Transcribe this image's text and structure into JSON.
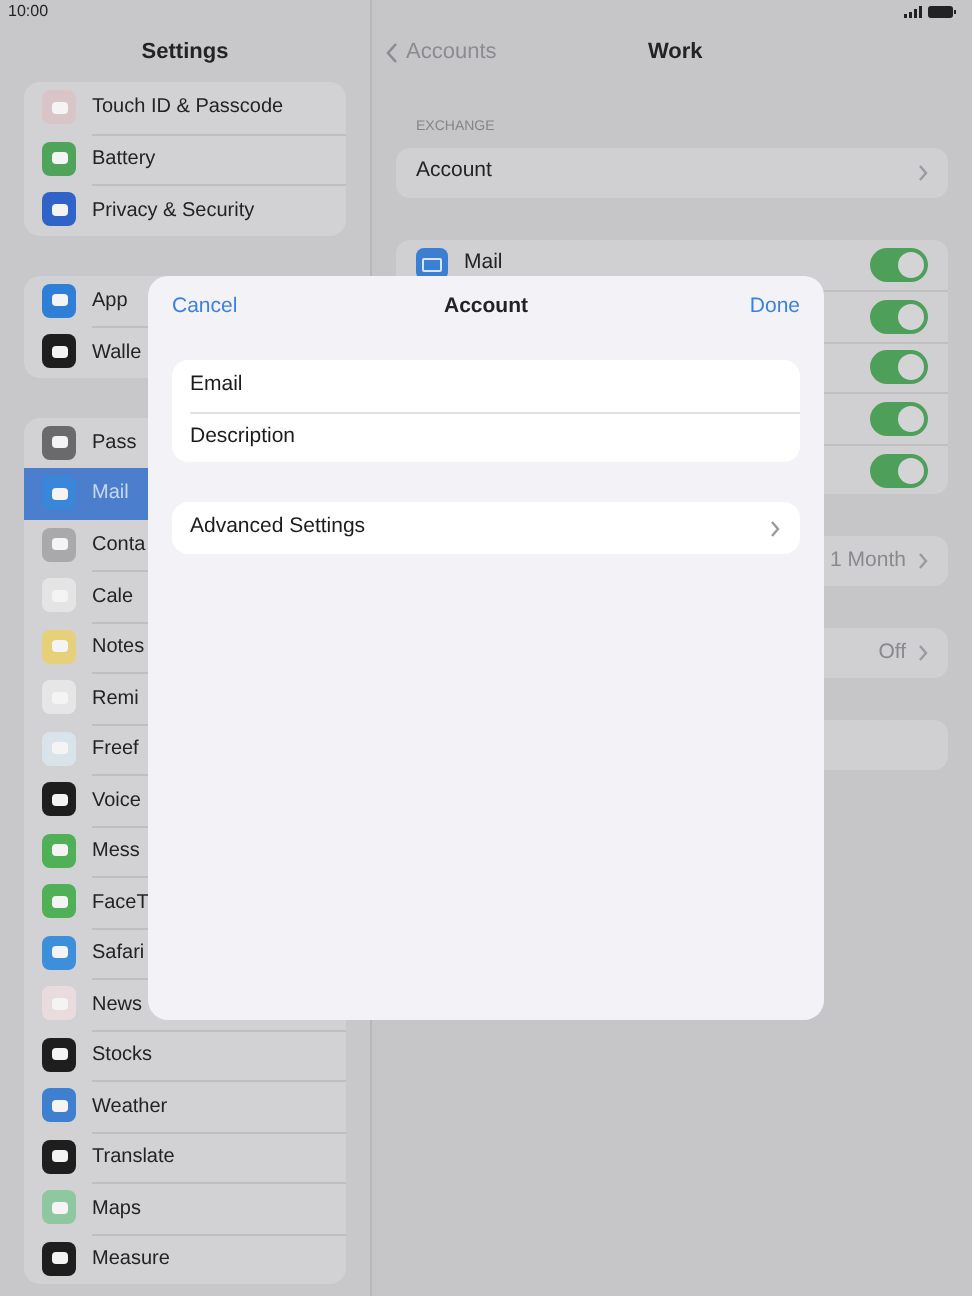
{
  "status_bar": {
    "time": "10:00"
  },
  "sidebar": {
    "title": "Settings",
    "groups": [
      [
        {
          "label": "Touch ID & Passcode",
          "color": "#d9c5c8",
          "selected": false
        },
        {
          "label": "Battery",
          "color": "#4fa35a",
          "selected": false
        },
        {
          "label": "Privacy & Security",
          "color": "#2f63c8",
          "selected": false
        }
      ],
      [
        {
          "label": "App",
          "color": "#2f7fd6",
          "selected": false
        },
        {
          "label": "Walle",
          "color": "#1e1e1e",
          "selected": false
        }
      ],
      [
        {
          "label": "Pass",
          "color": "#6a6a6c",
          "selected": false
        },
        {
          "label": "Mail",
          "color": "#3a86d9",
          "selected": true
        },
        {
          "label": "Conta",
          "color": "#a9a9ab",
          "selected": false
        },
        {
          "label": "Cale",
          "color": "#e4e4e4",
          "selected": false
        },
        {
          "label": "Notes",
          "color": "#e6d07a",
          "selected": false
        },
        {
          "label": "Remi",
          "color": "#e6e6e6",
          "selected": false
        },
        {
          "label": "Freef",
          "color": "#d8e4ea",
          "selected": false
        },
        {
          "label": "Voice",
          "color": "#1e1e1e",
          "selected": false
        },
        {
          "label": "Mess",
          "color": "#4fb058",
          "selected": false
        },
        {
          "label": "FaceT",
          "color": "#4fb058",
          "selected": false
        },
        {
          "label": "Safari",
          "color": "#3d8fdc",
          "selected": false
        },
        {
          "label": "News",
          "color": "#e8dcde",
          "selected": false
        },
        {
          "label": "Stocks",
          "color": "#1e1e1e",
          "selected": false
        },
        {
          "label": "Weather",
          "color": "#3f7fd0",
          "selected": false
        },
        {
          "label": "Translate",
          "color": "#1e1e1e",
          "selected": false
        },
        {
          "label": "Maps",
          "color": "#8fc7a0",
          "selected": false
        },
        {
          "label": "Measure",
          "color": "#1e1e1e",
          "selected": false
        }
      ]
    ]
  },
  "detail": {
    "back": "Accounts",
    "title": "Work",
    "section_label": "EXCHANGE",
    "account_row": "Account",
    "toggles": [
      {
        "label": "Mail",
        "on": true
      },
      {
        "on": true
      },
      {
        "on": true
      },
      {
        "on": true
      },
      {
        "on": true
      }
    ],
    "value_rows": [
      {
        "value": "1 Month"
      },
      {
        "value": "Off"
      },
      {}
    ]
  },
  "modal": {
    "cancel": "Cancel",
    "title": "Account",
    "done": "Done",
    "fields": [
      {
        "label": "Email"
      },
      {
        "label": "Description"
      }
    ],
    "advanced": "Advanced Settings"
  }
}
